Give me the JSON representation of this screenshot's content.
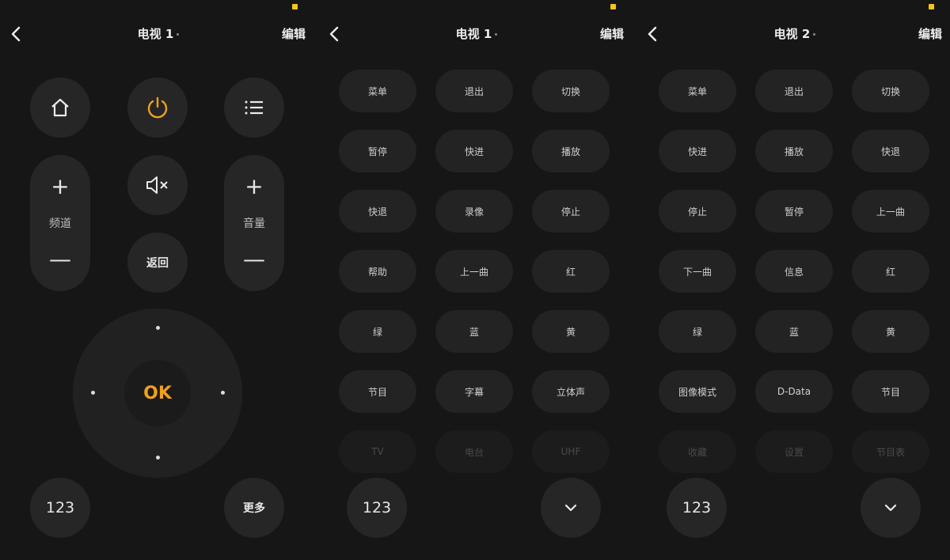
{
  "accent_color": "#f0a020",
  "panel1": {
    "title": "电视 1",
    "edit_label": "编辑",
    "channel_label": "频道",
    "volume_label": "音量",
    "back_label": "返回",
    "ok_label": "OK",
    "numpad_label": "123",
    "more_label": "更多"
  },
  "panel2": {
    "title": "电视 1",
    "edit_label": "编辑",
    "rows": [
      [
        "菜单",
        "退出",
        "切换"
      ],
      [
        "暂停",
        "快进",
        "播放"
      ],
      [
        "快退",
        "录像",
        "停止"
      ],
      [
        "帮助",
        "上一曲",
        "红"
      ],
      [
        "绿",
        "蓝",
        "黄"
      ],
      [
        "节目",
        "字幕",
        "立体声"
      ],
      [
        "TV",
        "电台",
        "UHF"
      ]
    ],
    "numpad_label": "123"
  },
  "panel3": {
    "title": "电视 2",
    "edit_label": "编辑",
    "rows": [
      [
        "菜单",
        "退出",
        "切换"
      ],
      [
        "快进",
        "播放",
        "快退"
      ],
      [
        "停止",
        "暂停",
        "上一曲"
      ],
      [
        "下一曲",
        "信息",
        "红"
      ],
      [
        "绿",
        "蓝",
        "黄"
      ],
      [
        "图像模式",
        "D-Data",
        "节目"
      ],
      [
        "收藏",
        "设置",
        "节目表"
      ]
    ],
    "numpad_label": "123"
  }
}
